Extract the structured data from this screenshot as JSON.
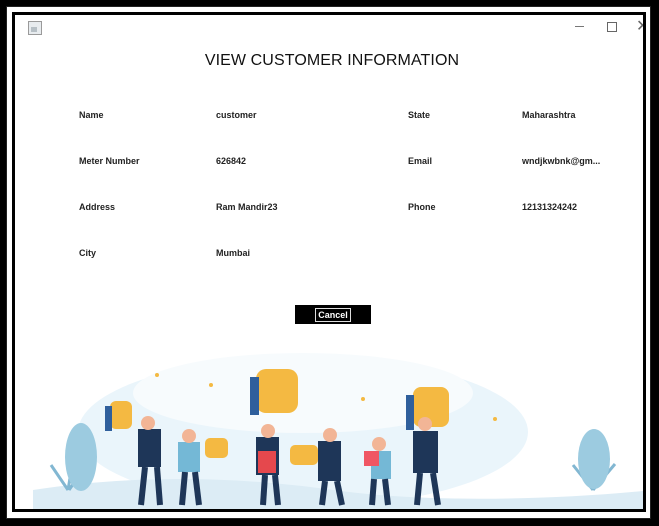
{
  "window": {
    "title": "VIEW CUSTOMER INFORMATION",
    "controls": [
      "–",
      "□",
      "✕"
    ]
  },
  "fields": [
    {
      "label": "Name",
      "value": "customer"
    },
    {
      "label": "Meter Number",
      "value": "626842"
    },
    {
      "label": "Address",
      "value": "Ram Mandir23"
    },
    {
      "label": "City",
      "value": "Mumbai"
    },
    {
      "label": "State",
      "value": "Maharashtra"
    },
    {
      "label": "Email",
      "value": "wndjkwbnk@gm..."
    },
    {
      "label": "Phone",
      "value": "12131324242"
    }
  ],
  "buttons": {
    "cancel": "Cancel"
  },
  "colors": {
    "background": "#ffffff",
    "button": "#000000",
    "accent_yellow": "#f4b942",
    "accent_blue": "#2f5f9c"
  },
  "illustration": {
    "icon": "thumbs-up-people-illustration"
  }
}
